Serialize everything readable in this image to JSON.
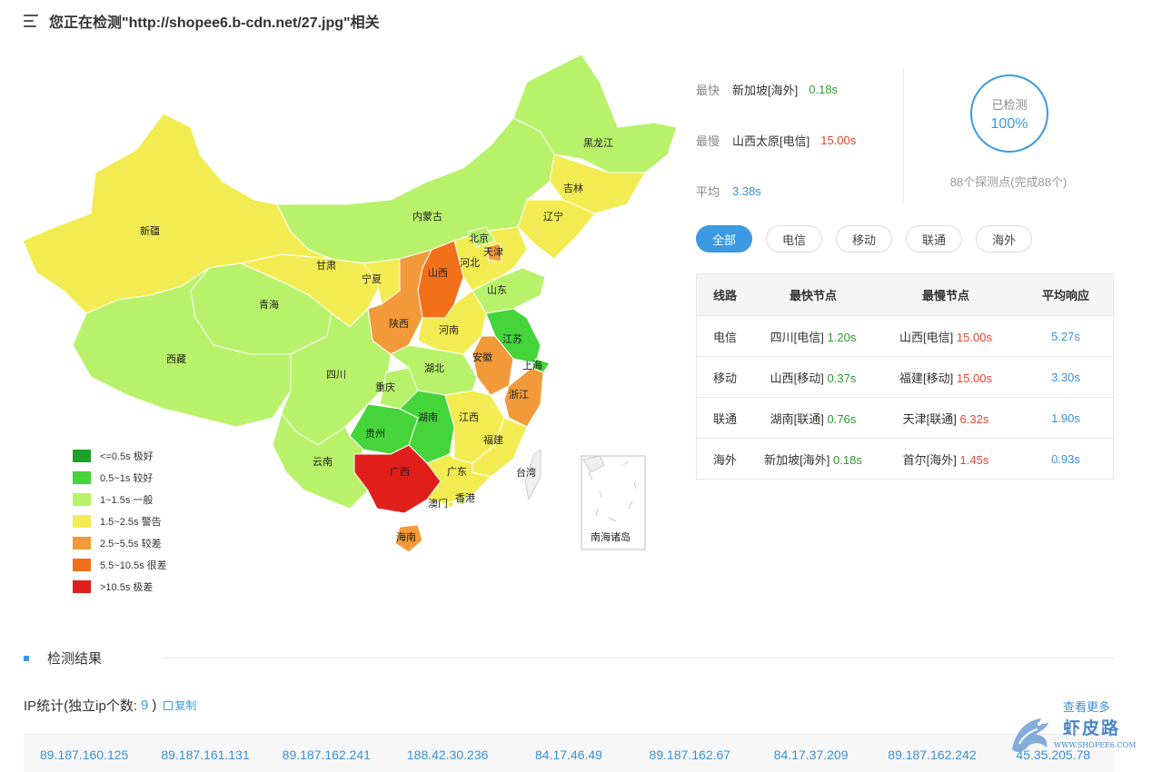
{
  "header": {
    "title": "您正在检测\"http://shopee6.b-cdn.net/27.jpg\"相关"
  },
  "map": {
    "provinces": [
      "黑龙江",
      "吉林",
      "辽宁",
      "内蒙古",
      "北京",
      "天津",
      "河北",
      "山西",
      "山东",
      "新疆",
      "甘肃",
      "宁夏",
      "青海",
      "陕西",
      "河南",
      "江苏",
      "安徽",
      "上海",
      "西藏",
      "四川",
      "湖北",
      "重庆",
      "浙江",
      "贵州",
      "湖南",
      "江西",
      "福建",
      "云南",
      "广西",
      "广东",
      "台湾",
      "香港",
      "澳门",
      "海南"
    ],
    "inset_label": "南海诸岛"
  },
  "legend": [
    {
      "label": "<=0.5s 极好",
      "color": "#1fa02a"
    },
    {
      "label": "0.5~1s 较好",
      "color": "#45d43a"
    },
    {
      "label": "1~1.5s 一般",
      "color": "#b8f26a"
    },
    {
      "label": "1.5~2.5s 警告",
      "color": "#f2ec52"
    },
    {
      "label": "2.5~5.5s 较差",
      "color": "#f29a3a"
    },
    {
      "label": "5.5~10.5s 很差",
      "color": "#f2701a"
    },
    {
      "label": ">10.5s 极差",
      "color": "#e01f1a"
    }
  ],
  "stats": {
    "fastest": {
      "label": "最快",
      "node": "新加坡[海外]",
      "value": "0.18s"
    },
    "slowest": {
      "label": "最慢",
      "node": "山西太原[电信]",
      "value": "15.00s"
    },
    "average": {
      "label": "平均",
      "value": "3.38s"
    }
  },
  "progress": {
    "label": "已检测",
    "value": "100%",
    "percent": 100,
    "probe_text": "88个探测点(完成88个)"
  },
  "tabs": [
    "全部",
    "电信",
    "移动",
    "联通",
    "海外"
  ],
  "table": {
    "headers": [
      "线路",
      "最快节点",
      "最慢节点",
      "平均响应"
    ],
    "rows": [
      {
        "line": "电信",
        "fast_node": "四川[电信]",
        "fast_val": "1.20s",
        "slow_node": "山西[电信]",
        "slow_val": "15.00s",
        "avg": "5.27s"
      },
      {
        "line": "移动",
        "fast_node": "山西[移动]",
        "fast_val": "0.37s",
        "slow_node": "福建[移动]",
        "slow_val": "15.00s",
        "avg": "3.30s"
      },
      {
        "line": "联通",
        "fast_node": "湖南[联通]",
        "fast_val": "0.76s",
        "slow_node": "天津[联通]",
        "slow_val": "6.32s",
        "avg": "1.90s"
      },
      {
        "line": "海外",
        "fast_node": "新加坡[海外]",
        "fast_val": "0.18s",
        "slow_node": "首尔[海外]",
        "slow_val": "1.45s",
        "avg": "0.93s"
      }
    ]
  },
  "results": {
    "section_title": "检测结果",
    "ip_stat_prefix": "IP统计(独立ip个数:",
    "ip_count": "9",
    "ip_stat_suffix": ")",
    "copy_label": "复制",
    "more_label": "查看更多",
    "ips": [
      "89.187.160.125",
      "89.187.161.131",
      "89.187.162.241",
      "188.42.30.236",
      "84.17.46.49",
      "89.187.162.67",
      "84.17.37.209",
      "89.187.162.242",
      "45.35.205.78"
    ]
  },
  "watermark": {
    "title": "虾皮路",
    "subtitle": "WWW.SHOPEE6.COM"
  }
}
